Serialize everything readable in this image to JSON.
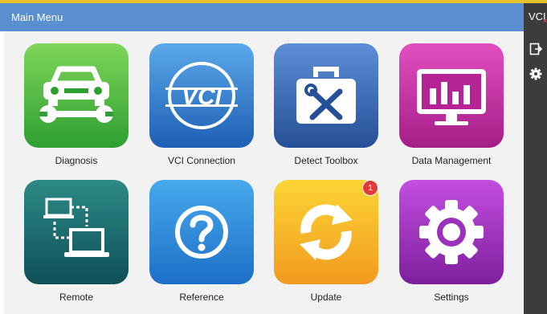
{
  "header": {
    "title": "Main Menu"
  },
  "sidebar": {
    "vci_label": "VCI",
    "buttons": [
      {
        "icon": "exit-icon"
      },
      {
        "icon": "gear-icon"
      }
    ]
  },
  "apps": [
    {
      "label": "Diagnosis",
      "icon": "car-wrench-icon",
      "color_top": "#7fd65a",
      "color_bottom": "#2e9f31"
    },
    {
      "label": "VCI Connection",
      "icon": "vci-icon",
      "color_top": "#5aa8ea",
      "color_bottom": "#1e5fb4"
    },
    {
      "label": "Detect Toolbox",
      "icon": "toolbox-icon",
      "color_top": "#5d8fd6",
      "color_bottom": "#254f97"
    },
    {
      "label": "Data Management",
      "icon": "monitor-chart-icon",
      "color_top": "#e24fc0",
      "color_bottom": "#a51e88"
    },
    {
      "label": "Remote",
      "icon": "remote-laptops-icon",
      "color_top": "#2c8a86",
      "color_bottom": "#0f4f57"
    },
    {
      "label": "Reference",
      "icon": "question-icon",
      "color_top": "#47a9ec",
      "color_bottom": "#1d6fc8"
    },
    {
      "label": "Update",
      "icon": "refresh-icon",
      "color_top": "#fcd535",
      "color_bottom": "#f29a1f",
      "badge": "1"
    },
    {
      "label": "Settings",
      "icon": "gear-icon",
      "color_top": "#c34ee0",
      "color_bottom": "#7e1f9d"
    }
  ]
}
